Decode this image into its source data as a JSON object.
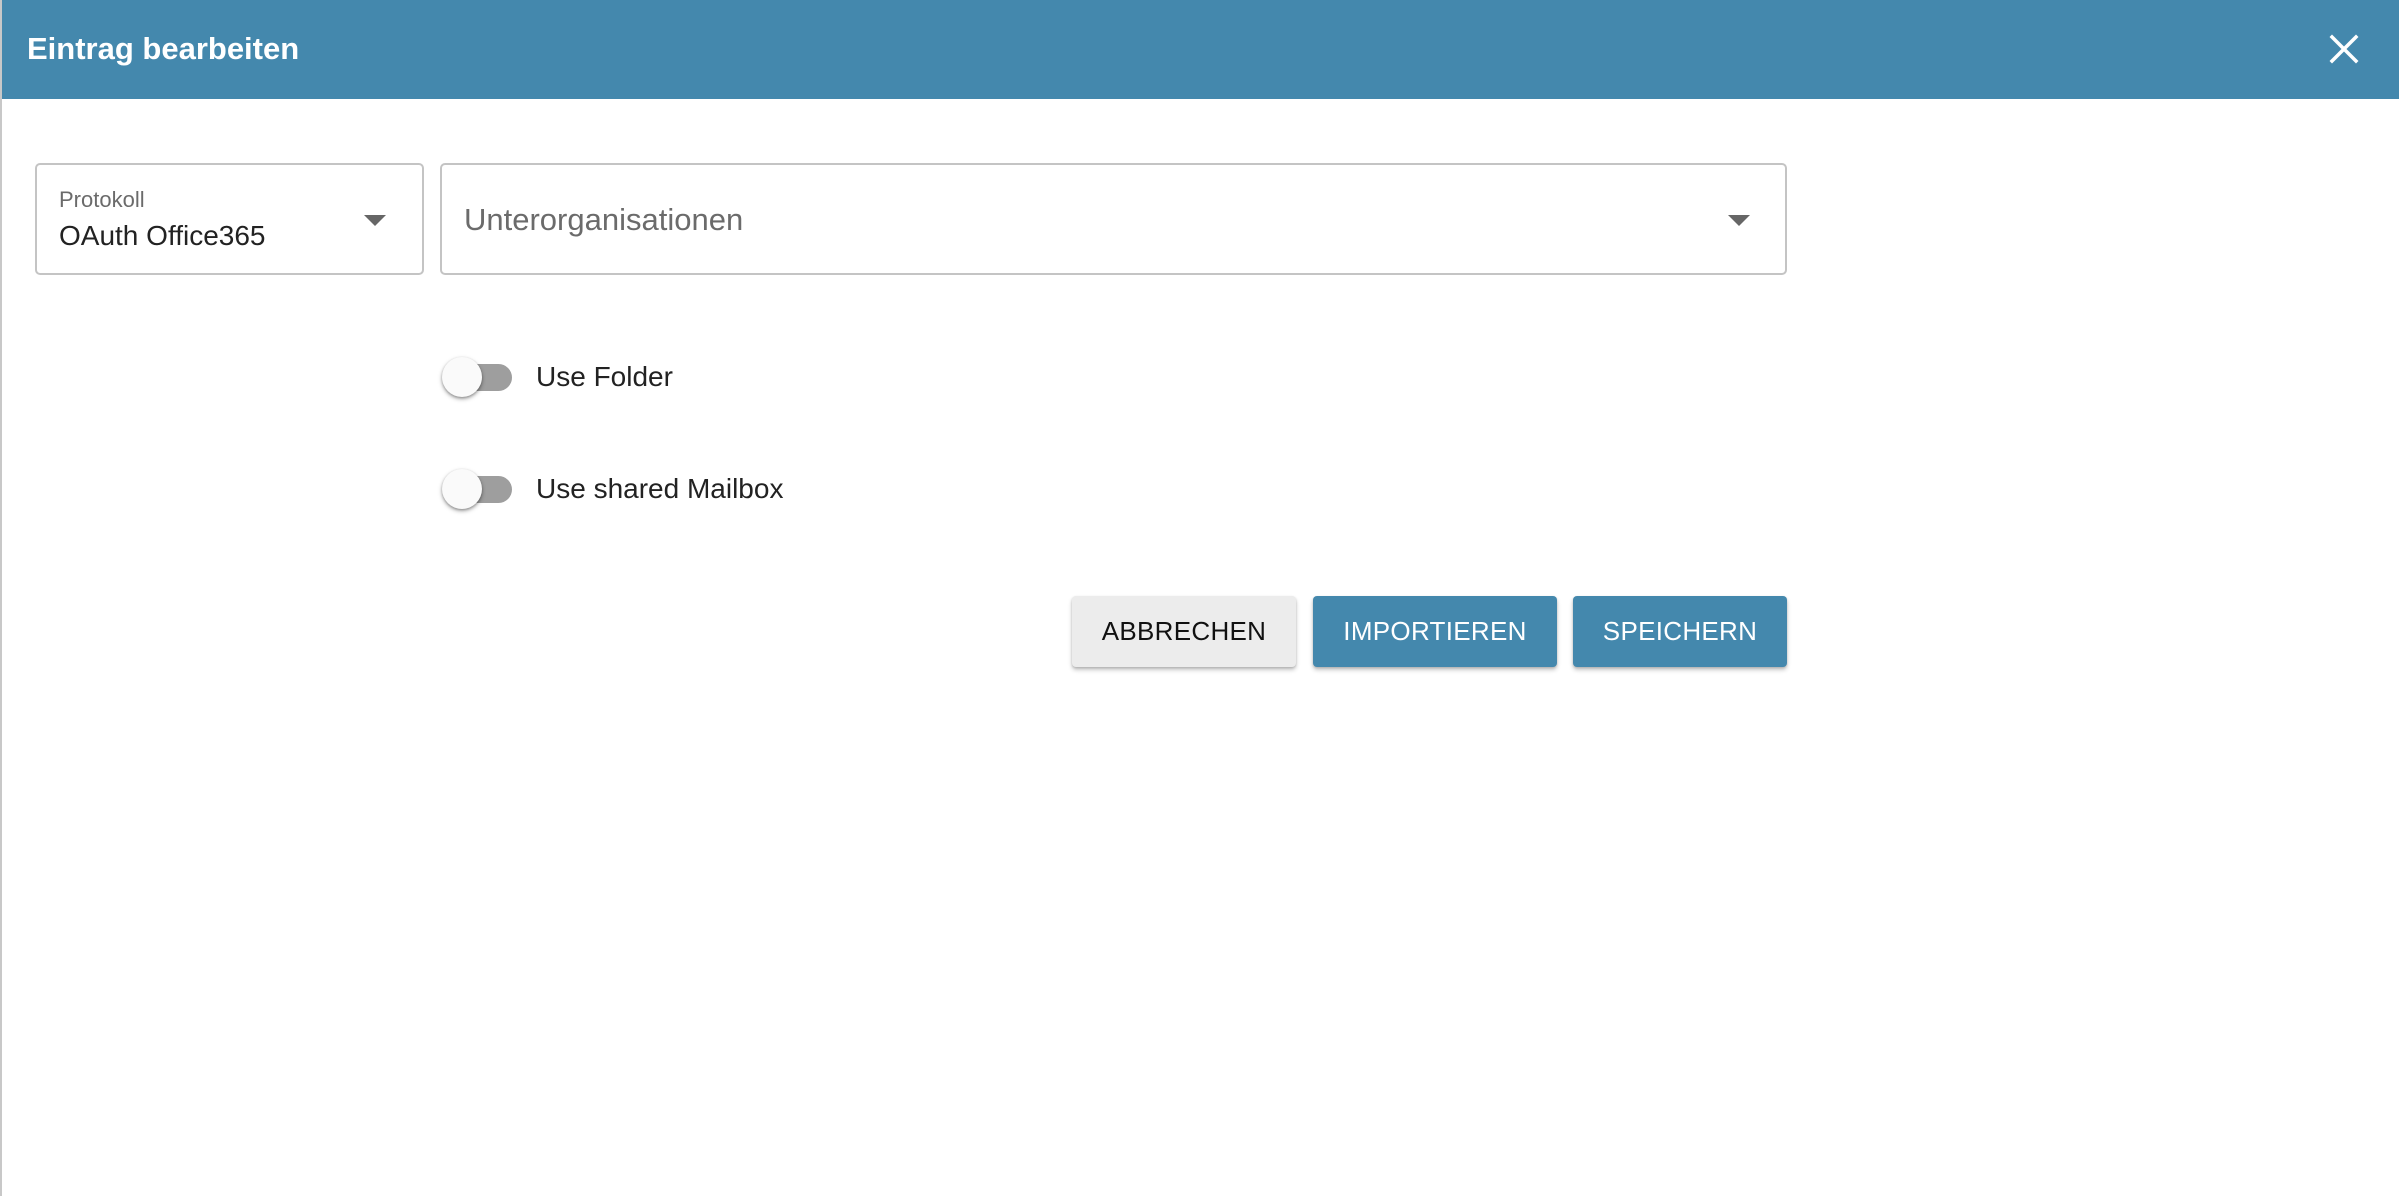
{
  "dialog": {
    "title": "Eintrag bearbeiten",
    "close_icon": "close-icon"
  },
  "form": {
    "protokoll": {
      "label": "Protokoll",
      "value": "OAuth Office365",
      "icon": "chevron-down-icon"
    },
    "unterorganisationen": {
      "placeholder": "Unterorganisationen",
      "icon": "chevron-down-icon"
    },
    "use_folder": {
      "label": "Use Folder",
      "checked": false
    },
    "use_shared_mailbox": {
      "label": "Use shared Mailbox",
      "checked": false
    }
  },
  "actions": {
    "cancel_label": "ABBRECHEN",
    "import_label": "IMPORTIEREN",
    "save_label": "SPEICHERN"
  },
  "colors": {
    "primary": "#4488ad",
    "cancel_bg": "#ececec",
    "toggle_off_track": "#9e9e9e"
  }
}
